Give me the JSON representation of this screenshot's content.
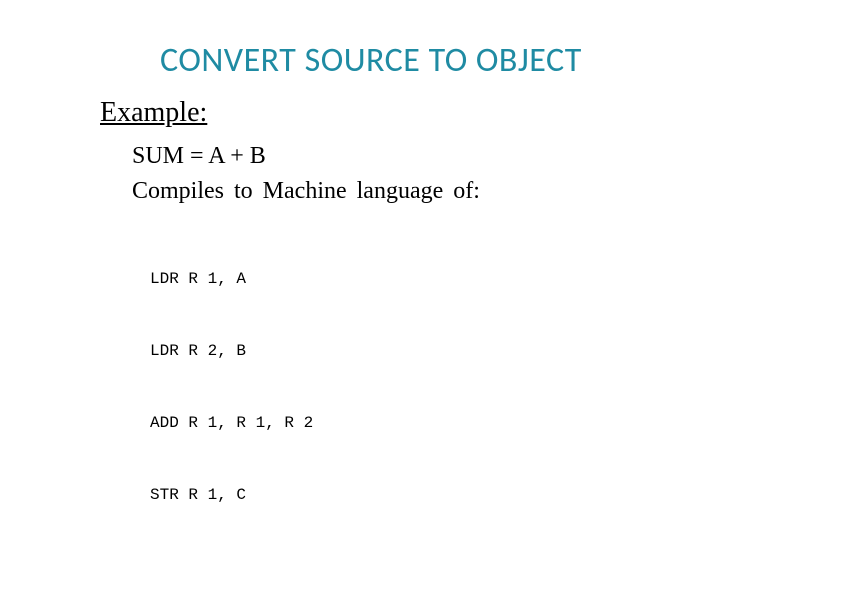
{
  "title": "CONVERT SOURCE TO OBJECT",
  "example_label": "Example:",
  "equation": "SUM = A + B",
  "compiles": "Compiles to Machine language of:",
  "code_lines": [
    "LDR R 1, A",
    "LDR R 2, B",
    "ADD R 1, R 1, R 2",
    "STR R 1, C"
  ]
}
